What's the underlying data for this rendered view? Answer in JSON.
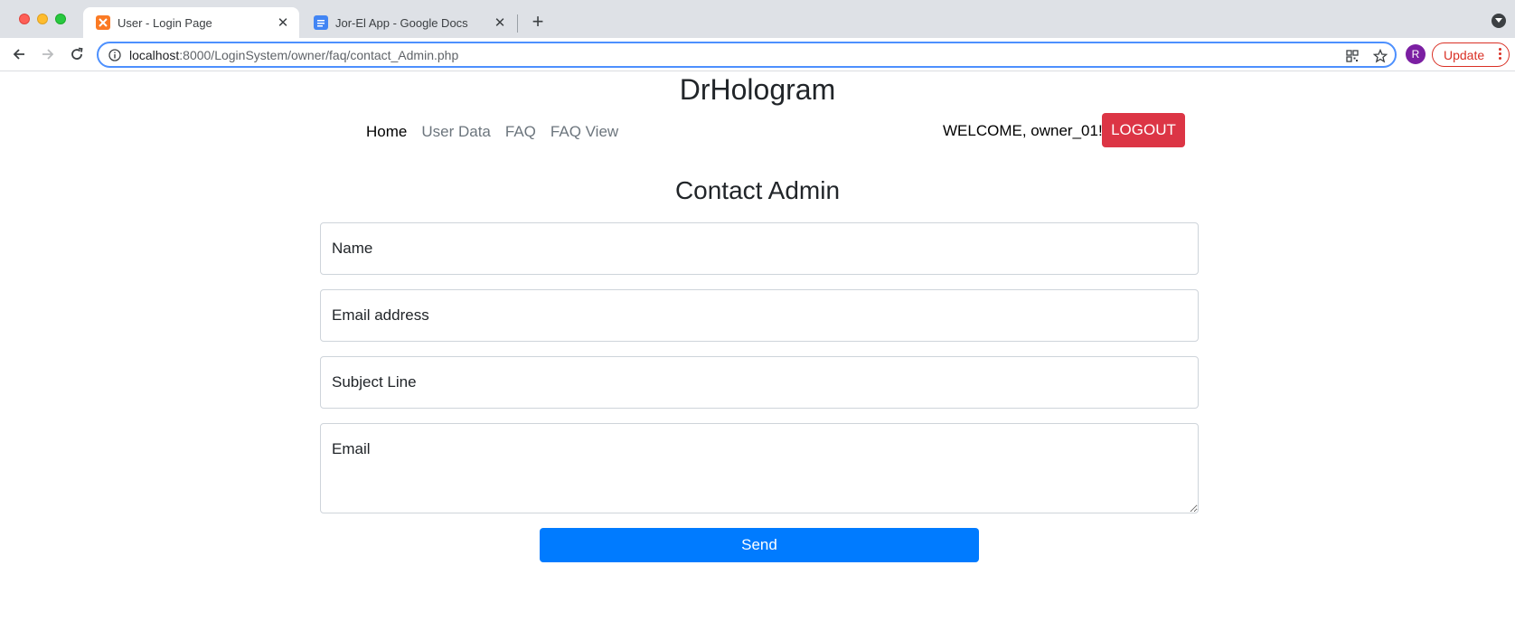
{
  "browser": {
    "tabs": [
      {
        "title": "User - Login Page",
        "favicon": "xampp-icon",
        "active": true
      },
      {
        "title": "Jor-El App - Google Docs",
        "favicon": "google-docs-icon",
        "active": false
      }
    ],
    "url_host": "localhost",
    "url_path": ":8000/LoginSystem/owner/faq/contact_Admin.php",
    "profile_initial": "R",
    "update_label": "Update"
  },
  "site": {
    "brand": "DrHologram",
    "nav": [
      {
        "label": "Home"
      },
      {
        "label": "User Data"
      },
      {
        "label": "FAQ"
      },
      {
        "label": "FAQ View"
      }
    ],
    "welcome": "WELCOME, owner_01! -",
    "logout_label": "LOGOUT"
  },
  "form": {
    "title": "Contact Admin",
    "name_placeholder": "Name",
    "email_placeholder": "Email address",
    "subject_placeholder": "Subject Line",
    "body_placeholder": "Email",
    "send_label": "Send"
  },
  "colors": {
    "logout": "#dc3545",
    "send": "#007bff",
    "focus_ring": "#4d90fe"
  }
}
